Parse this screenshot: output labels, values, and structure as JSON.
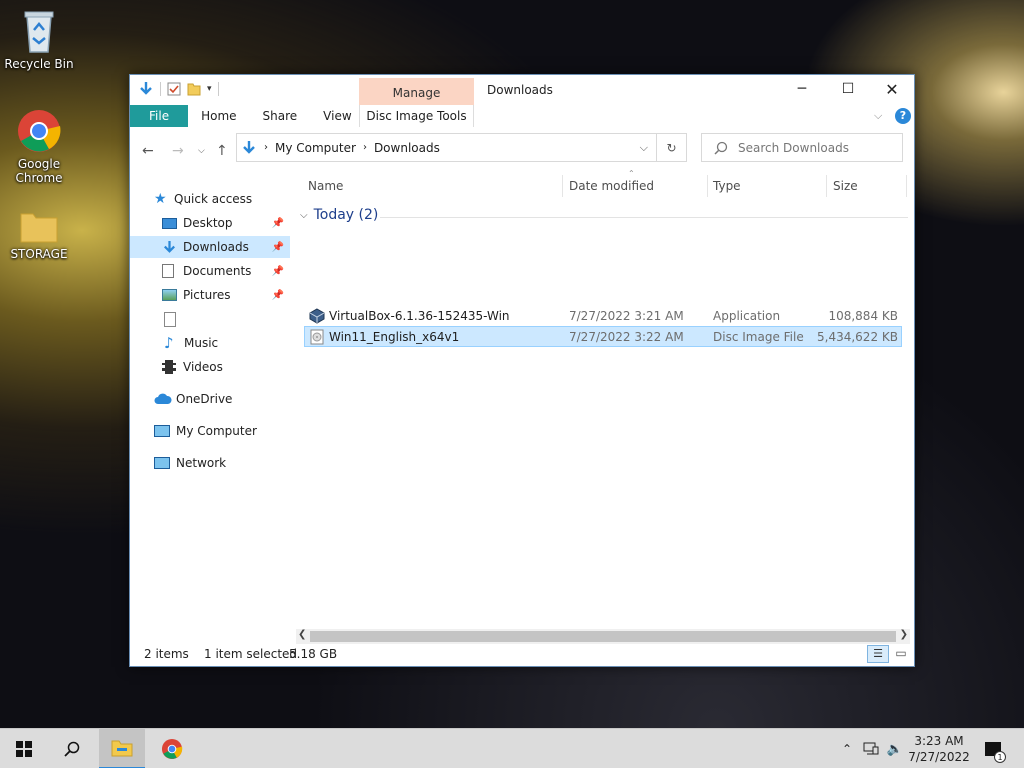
{
  "desktop": {
    "icons": [
      {
        "label": "Recycle Bin"
      },
      {
        "label": "Google Chrome"
      },
      {
        "label": "STORAGE"
      }
    ]
  },
  "window": {
    "title": "Downloads",
    "contextual_group": "Manage",
    "ribbon_tabs": [
      "File",
      "Home",
      "Share",
      "View"
    ],
    "contextual_tab": "Disc Image Tools",
    "breadcrumb": [
      "My Computer",
      "Downloads"
    ],
    "search_placeholder": "Search Downloads",
    "navigation": [
      {
        "label": "Quick access",
        "icon": "star-icon"
      },
      {
        "label": "Desktop",
        "icon": "desktop-icon",
        "pinned": true
      },
      {
        "label": "Downloads",
        "icon": "download-arrow-icon",
        "pinned": true,
        "selected": true
      },
      {
        "label": "Documents",
        "icon": "documents-icon",
        "pinned": true
      },
      {
        "label": "Pictures",
        "icon": "pictures-icon",
        "pinned": true
      },
      {
        "label": "",
        "icon": "blank-file-icon"
      },
      {
        "label": "Music",
        "icon": "music-note-icon"
      },
      {
        "label": "Videos",
        "icon": "film-icon"
      },
      {
        "label": "OneDrive",
        "icon": "cloud-icon"
      },
      {
        "label": "My Computer",
        "icon": "computer-icon"
      },
      {
        "label": "Network",
        "icon": "network-icon"
      }
    ],
    "columns": [
      "Name",
      "Date modified",
      "Type",
      "Size"
    ],
    "group_label": "Today (2)",
    "files": [
      {
        "name": "VirtualBox-6.1.36-152435-Win",
        "date": "7/27/2022 3:21 AM",
        "type": "Application",
        "size": "108,884 KB",
        "icon": "virtualbox-icon"
      },
      {
        "name": "Win11_English_x64v1",
        "date": "7/27/2022 3:22 AM",
        "type": "Disc Image File",
        "size": "5,434,622 KB",
        "icon": "disc-image-icon",
        "selected": true
      }
    ],
    "status": {
      "item_count": "2 items",
      "selection": "1 item selected",
      "selection_size": "5.18 GB"
    }
  },
  "taskbar": {
    "time": "3:23 AM",
    "date": "7/27/2022",
    "notification_count": "1"
  },
  "colors": {
    "file_tab": "#1f9b9b",
    "manage_tab": "#fbd5c4",
    "selection": "#cce8ff",
    "group_header": "#1e3f8c",
    "accent_blue": "#2b88d8"
  }
}
